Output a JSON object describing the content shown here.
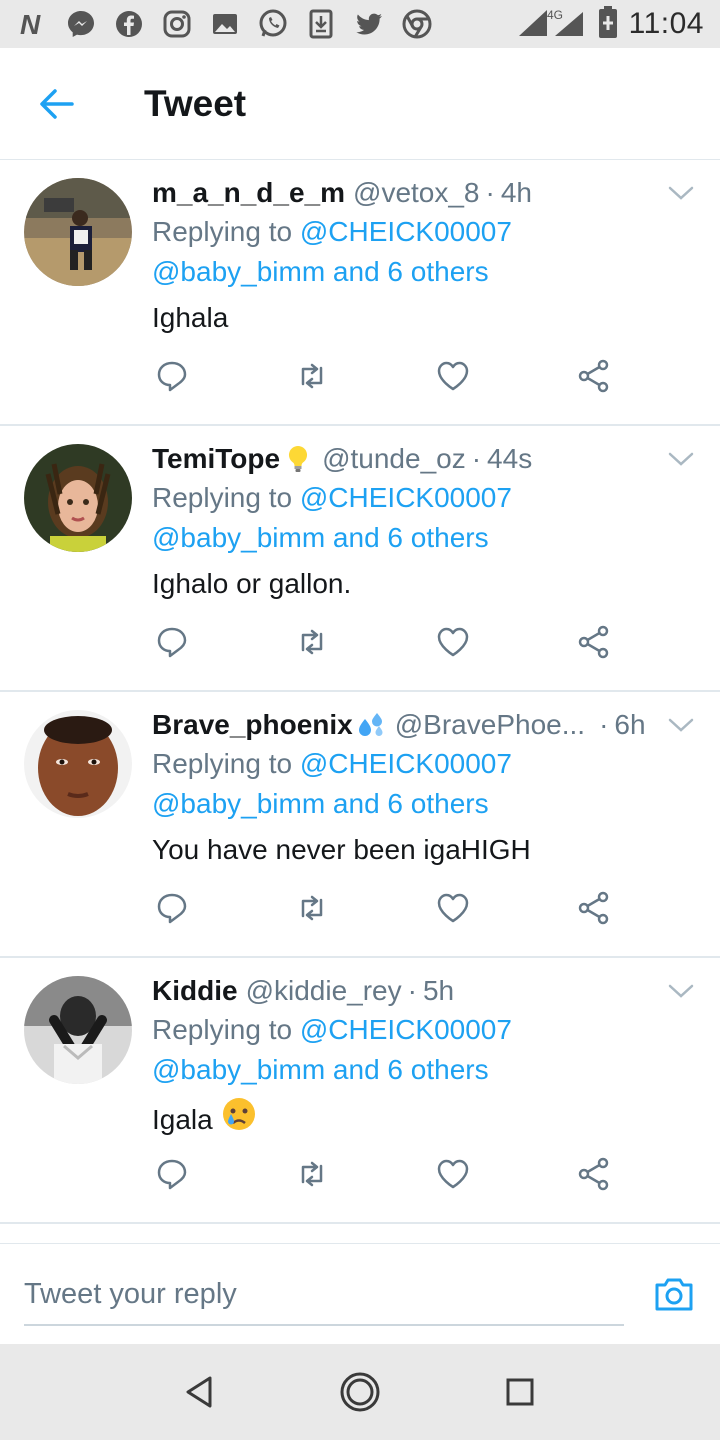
{
  "status_bar": {
    "time": "11:04",
    "network": "4G",
    "icons": [
      "n-app-icon",
      "messenger-icon",
      "facebook-icon",
      "instagram-icon",
      "gallery-icon",
      "whatsapp-icon",
      "download-icon",
      "twitter-icon",
      "chrome-icon"
    ]
  },
  "header": {
    "title": "Tweet",
    "back_icon": "arrow-left-icon"
  },
  "tweets": [
    {
      "name": "m_a_n_d_e_m",
      "name_emoji": "",
      "handle": "@vetox_8",
      "time": "4h",
      "replying_prefix": "Replying to",
      "reply_to": "@CHEICK00007",
      "reply_others": "@baby_bimm and 6 others",
      "text": "Ighala",
      "text_emoji": ""
    },
    {
      "name": "TemiTope",
      "name_emoji": "light-bulb-emoji",
      "handle": "@tunde_oz",
      "time": "44s",
      "replying_prefix": "Replying to",
      "reply_to": "@CHEICK00007",
      "reply_others": "@baby_bimm and 6 others",
      "text": "Ighalo or gallon.",
      "text_emoji": ""
    },
    {
      "name": "Brave_phoenix",
      "name_emoji": "sweat-droplets-emoji",
      "handle": "@BravePhoe...",
      "time": "6h",
      "replying_prefix": "Replying to",
      "reply_to": "@CHEICK00007",
      "reply_others": "@baby_bimm and 6 others",
      "text": "You have never been igaHIGH",
      "text_emoji": ""
    },
    {
      "name": "Kiddie",
      "name_emoji": "",
      "handle": "@kiddie_rey",
      "time": "5h",
      "replying_prefix": "Replying to",
      "reply_to": "@CHEICK00007",
      "reply_others": "@baby_bimm and 6 others",
      "text": "Igala",
      "text_emoji": "crying-face-emoji"
    }
  ],
  "composer": {
    "placeholder": "Tweet your reply"
  },
  "colors": {
    "accent": "#1da1f2",
    "text": "#14171a",
    "muted": "#657786",
    "divider": "#e1e8ed"
  }
}
